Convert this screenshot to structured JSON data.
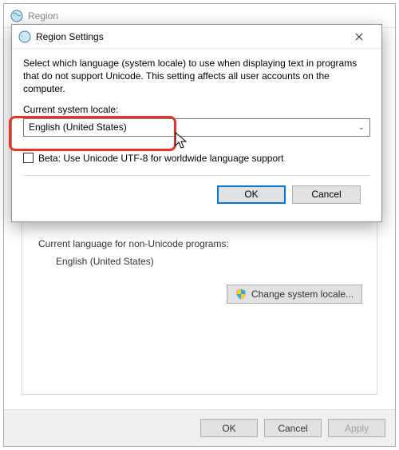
{
  "parent": {
    "title": "Region",
    "section_label": "Current language for non-Unicode programs:",
    "current_language": "English (United States)",
    "change_button": "Change system locale...",
    "ok": "OK",
    "cancel": "Cancel",
    "apply": "Apply"
  },
  "dialog": {
    "title": "Region Settings",
    "description": "Select which language (system locale) to use when displaying text in programs that do not support Unicode. This setting affects all user accounts on the computer.",
    "locale_label": "Current system locale:",
    "locale_value": "English (United States)",
    "beta_label": "Beta: Use Unicode UTF-8 for worldwide language support",
    "ok": "OK",
    "cancel": "Cancel"
  }
}
